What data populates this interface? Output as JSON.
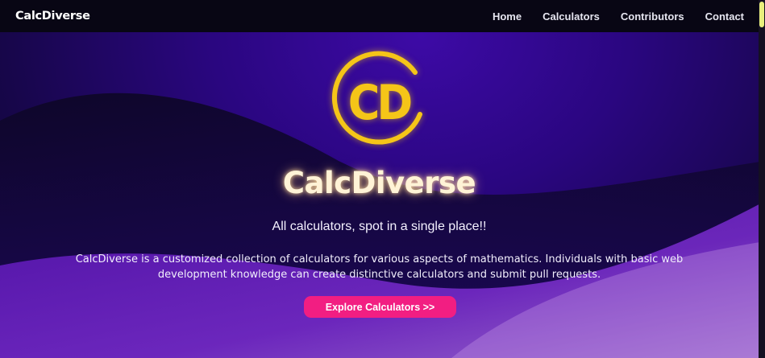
{
  "navbar": {
    "brand": "CalcDiverse",
    "links": [
      "Home",
      "Calculators",
      "Contributors",
      "Contact"
    ]
  },
  "hero": {
    "logo_text": "CD",
    "title": "CalcDiverse",
    "tagline": "All calculators, spot in a single place!!",
    "description": "CalcDiverse is a customized collection of calculators for various aspects of mathematics. Individuals with basic web development knowledge can create distinctive calculators and submit pull requests.",
    "cta_label": "Explore Calculators >>"
  },
  "colors": {
    "navbar_bg": "#080614",
    "hero_bg": "#2a0680",
    "logo_gold": "#f5c518",
    "cta_bg": "#f21e82",
    "scroll_thumb": "#e9ef7d"
  }
}
